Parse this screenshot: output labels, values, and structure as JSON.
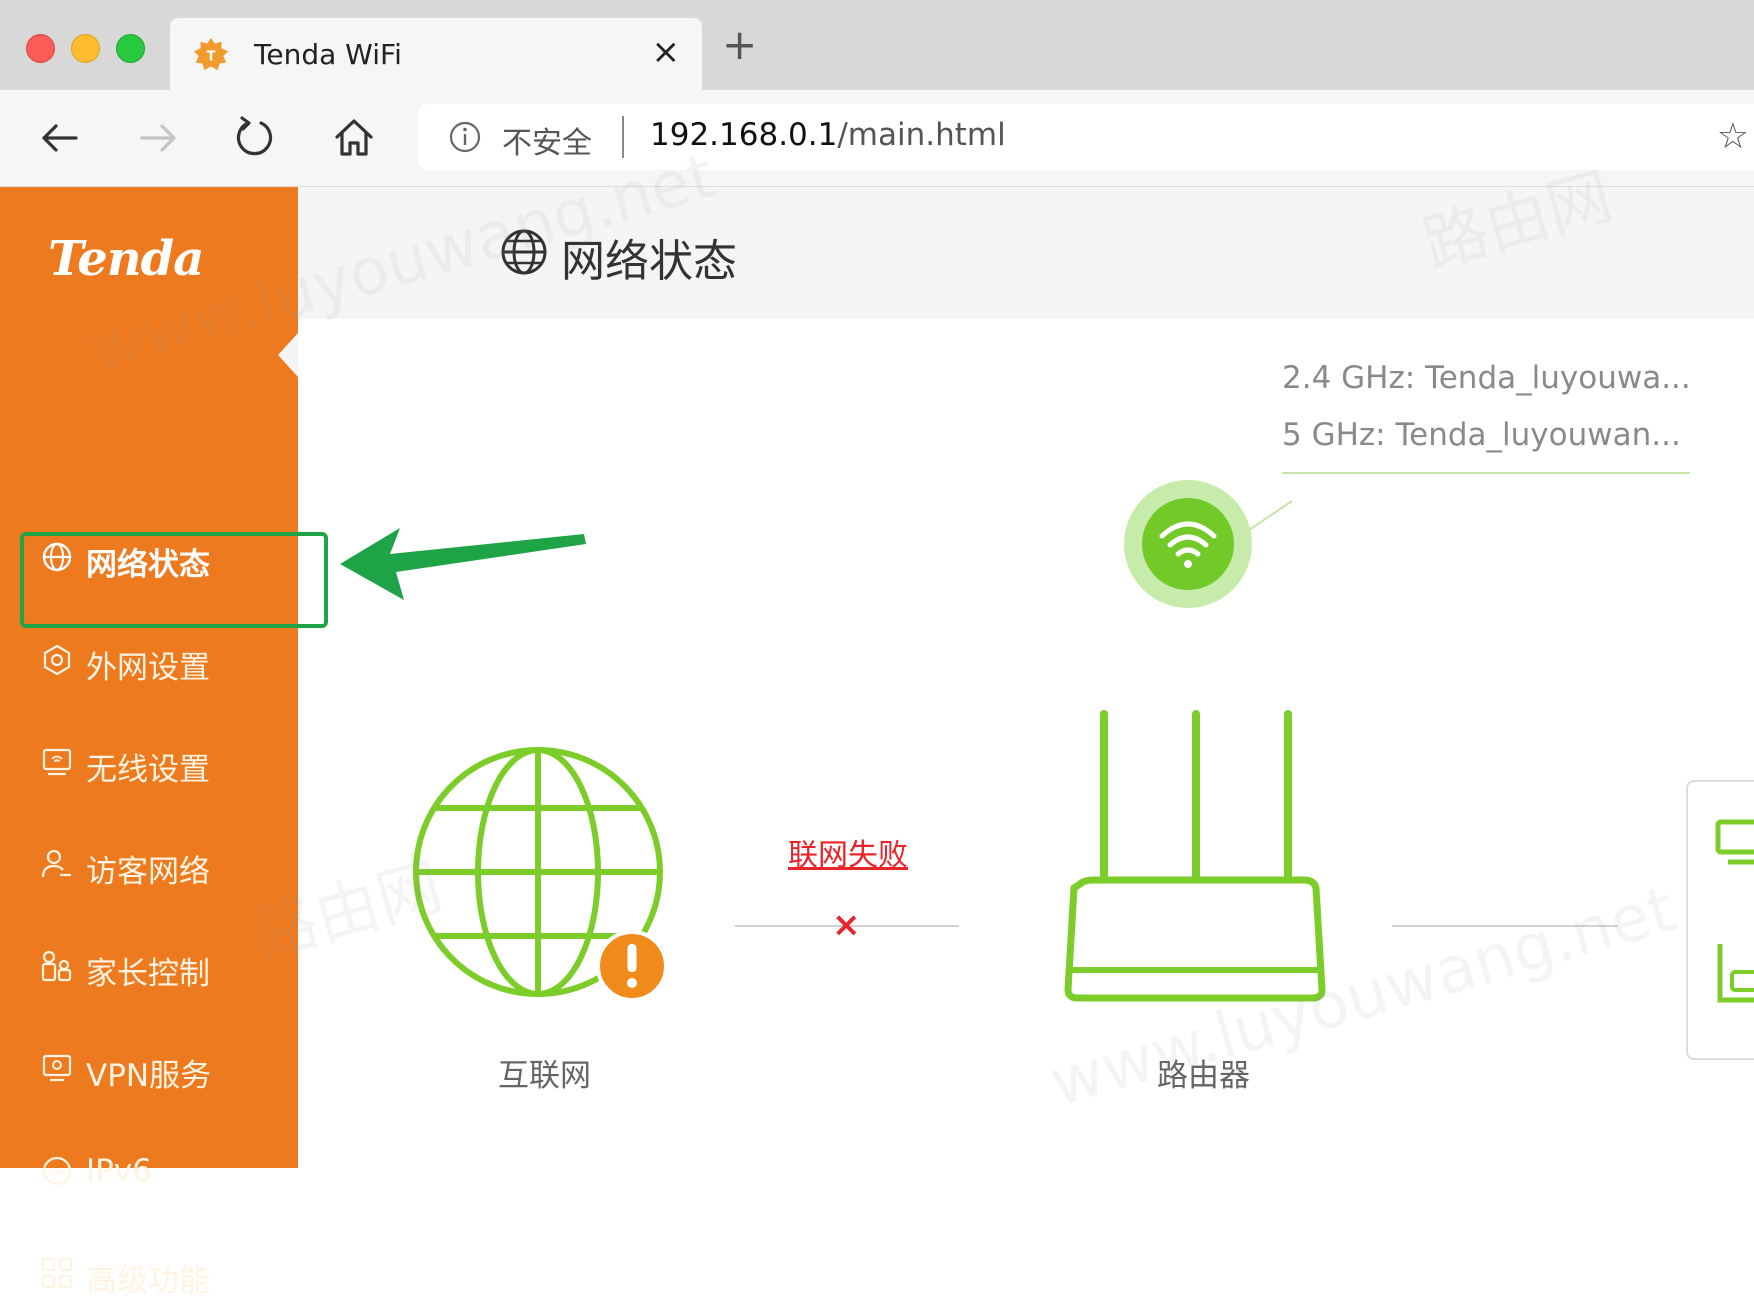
{
  "browser": {
    "tab_title": "Tenda WiFi",
    "tab_close": "×",
    "new_tab": "+",
    "insecure_label": "不安全",
    "url_host": "192.168.0.1",
    "url_path": "/main.html",
    "star": "☆"
  },
  "sidebar": {
    "logo": "Tenda",
    "items": [
      {
        "label": "网络状态",
        "icon": "globe-icon",
        "active": true
      },
      {
        "label": "外网设置",
        "icon": "wan-settings-icon"
      },
      {
        "label": "无线设置",
        "icon": "wireless-settings-icon"
      },
      {
        "label": "访客网络",
        "icon": "guest-network-icon"
      },
      {
        "label": "家长控制",
        "icon": "parental-control-icon"
      },
      {
        "label": "VPN服务",
        "icon": "vpn-icon"
      },
      {
        "label": "IPv6",
        "icon": "ipv6-icon"
      },
      {
        "label": "高级功能",
        "icon": "advanced-icon"
      }
    ]
  },
  "main": {
    "title": "网络状态",
    "ssid_24": "2.4 GHz: Tenda_luyouwa...",
    "ssid_5": "5 GHz: Tenda_luyouwan...",
    "connection_status": "联网失败",
    "fail_mark": "×",
    "internet_label": "互联网",
    "router_label": "路由器"
  },
  "watermarks": [
    "www.luyouwang.net",
    "路由网"
  ],
  "colors": {
    "sidebar_bg": "#ee7a1f",
    "accent_green": "#7ccc2a",
    "highlight_green": "#1ea446",
    "error_red": "#e8242a",
    "warning_orange": "#f08a1a"
  }
}
